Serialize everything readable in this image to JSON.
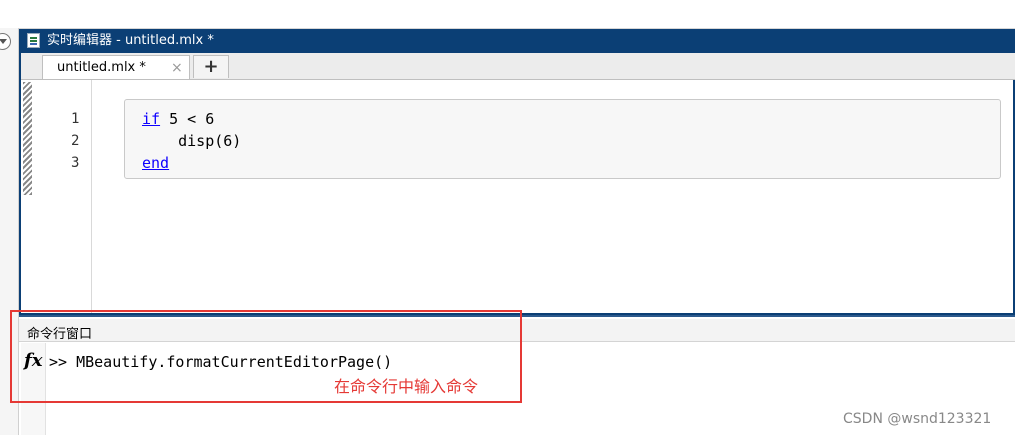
{
  "editor": {
    "window_title": "实时编辑器 - untitled.mlx *",
    "tab_label": "untitled.mlx *",
    "tab_close_glyph": "×",
    "add_tab_glyph": "+",
    "line_numbers": [
      "1",
      "2",
      "3"
    ],
    "code": {
      "line1_kw": "if",
      "line1_rest": " 5 < 6",
      "line2": "    disp(6)",
      "line3_kw": "end"
    }
  },
  "command_window": {
    "title": "命令行窗口",
    "fx_glyph": "fx",
    "prompt": ">> MBeautify.formatCurrentEditorPage()"
  },
  "annotation": "在命令行中输入命令",
  "watermark": "CSDN @wsnd123321",
  "colors": {
    "titlebar": "#0b3f75",
    "keyword": "#0e00ff",
    "annotation": "#e53935"
  }
}
